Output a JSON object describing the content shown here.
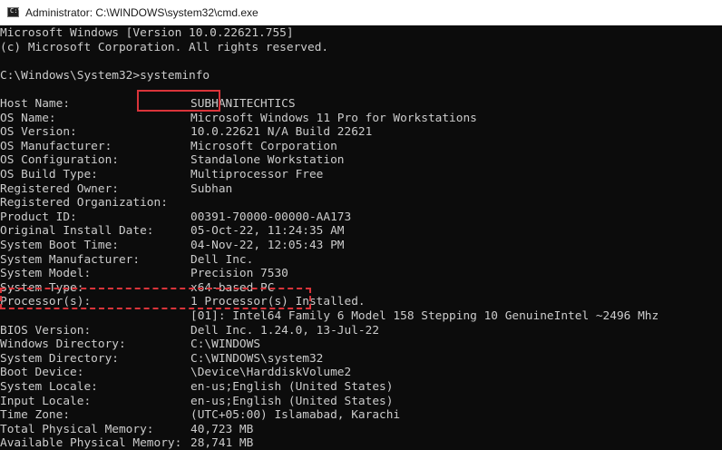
{
  "window": {
    "title": "Administrator: C:\\WINDOWS\\system32\\cmd.exe",
    "icon": "cmd-icon"
  },
  "console": {
    "header": [
      "Microsoft Windows [Version 10.0.22621.755]",
      "(c) Microsoft Corporation. All rights reserved."
    ],
    "prompt": "C:\\Windows\\System32>",
    "command": "systeminfo",
    "info": [
      {
        "key": "Host Name:",
        "value": "SUBHANITECHTICS"
      },
      {
        "key": "OS Name:",
        "value": "Microsoft Windows 11 Pro for Workstations"
      },
      {
        "key": "OS Version:",
        "value": "10.0.22621 N/A Build 22621"
      },
      {
        "key": "OS Manufacturer:",
        "value": "Microsoft Corporation"
      },
      {
        "key": "OS Configuration:",
        "value": "Standalone Workstation"
      },
      {
        "key": "OS Build Type:",
        "value": "Multiprocessor Free"
      },
      {
        "key": "Registered Owner:",
        "value": "Subhan"
      },
      {
        "key": "Registered Organization:",
        "value": ""
      },
      {
        "key": "Product ID:",
        "value": "00391-70000-00000-AA173"
      },
      {
        "key": "Original Install Date:",
        "value": "05-Oct-22, 11:24:35 AM"
      },
      {
        "key": "System Boot Time:",
        "value": "04-Nov-22, 12:05:43 PM"
      },
      {
        "key": "System Manufacturer:",
        "value": "Dell Inc."
      },
      {
        "key": "System Model:",
        "value": "Precision 7530"
      },
      {
        "key": "System Type:",
        "value": "x64-based PC"
      },
      {
        "key": "Processor(s):",
        "value": "1 Processor(s) Installed."
      },
      {
        "key": "",
        "value": "[01]: Intel64 Family 6 Model 158 Stepping 10 GenuineIntel ~2496 Mhz"
      },
      {
        "key": "BIOS Version:",
        "value": "Dell Inc. 1.24.0, 13-Jul-22"
      },
      {
        "key": "Windows Directory:",
        "value": "C:\\WINDOWS"
      },
      {
        "key": "System Directory:",
        "value": "C:\\WINDOWS\\system32"
      },
      {
        "key": "Boot Device:",
        "value": "\\Device\\HarddiskVolume2"
      },
      {
        "key": "System Locale:",
        "value": "en-us;English (United States)"
      },
      {
        "key": "Input Locale:",
        "value": "en-us;English (United States)"
      },
      {
        "key": "Time Zone:",
        "value": "(UTC+05:00) Islamabad, Karachi"
      },
      {
        "key": "Total Physical Memory:",
        "value": "40,723 MB"
      },
      {
        "key": "Available Physical Memory:",
        "value": "28,741 MB"
      }
    ]
  },
  "colors": {
    "console_background": "#0c0c0c",
    "console_text": "#cccccc",
    "titlebar_background": "#ffffff",
    "highlight": "#d9343a"
  }
}
